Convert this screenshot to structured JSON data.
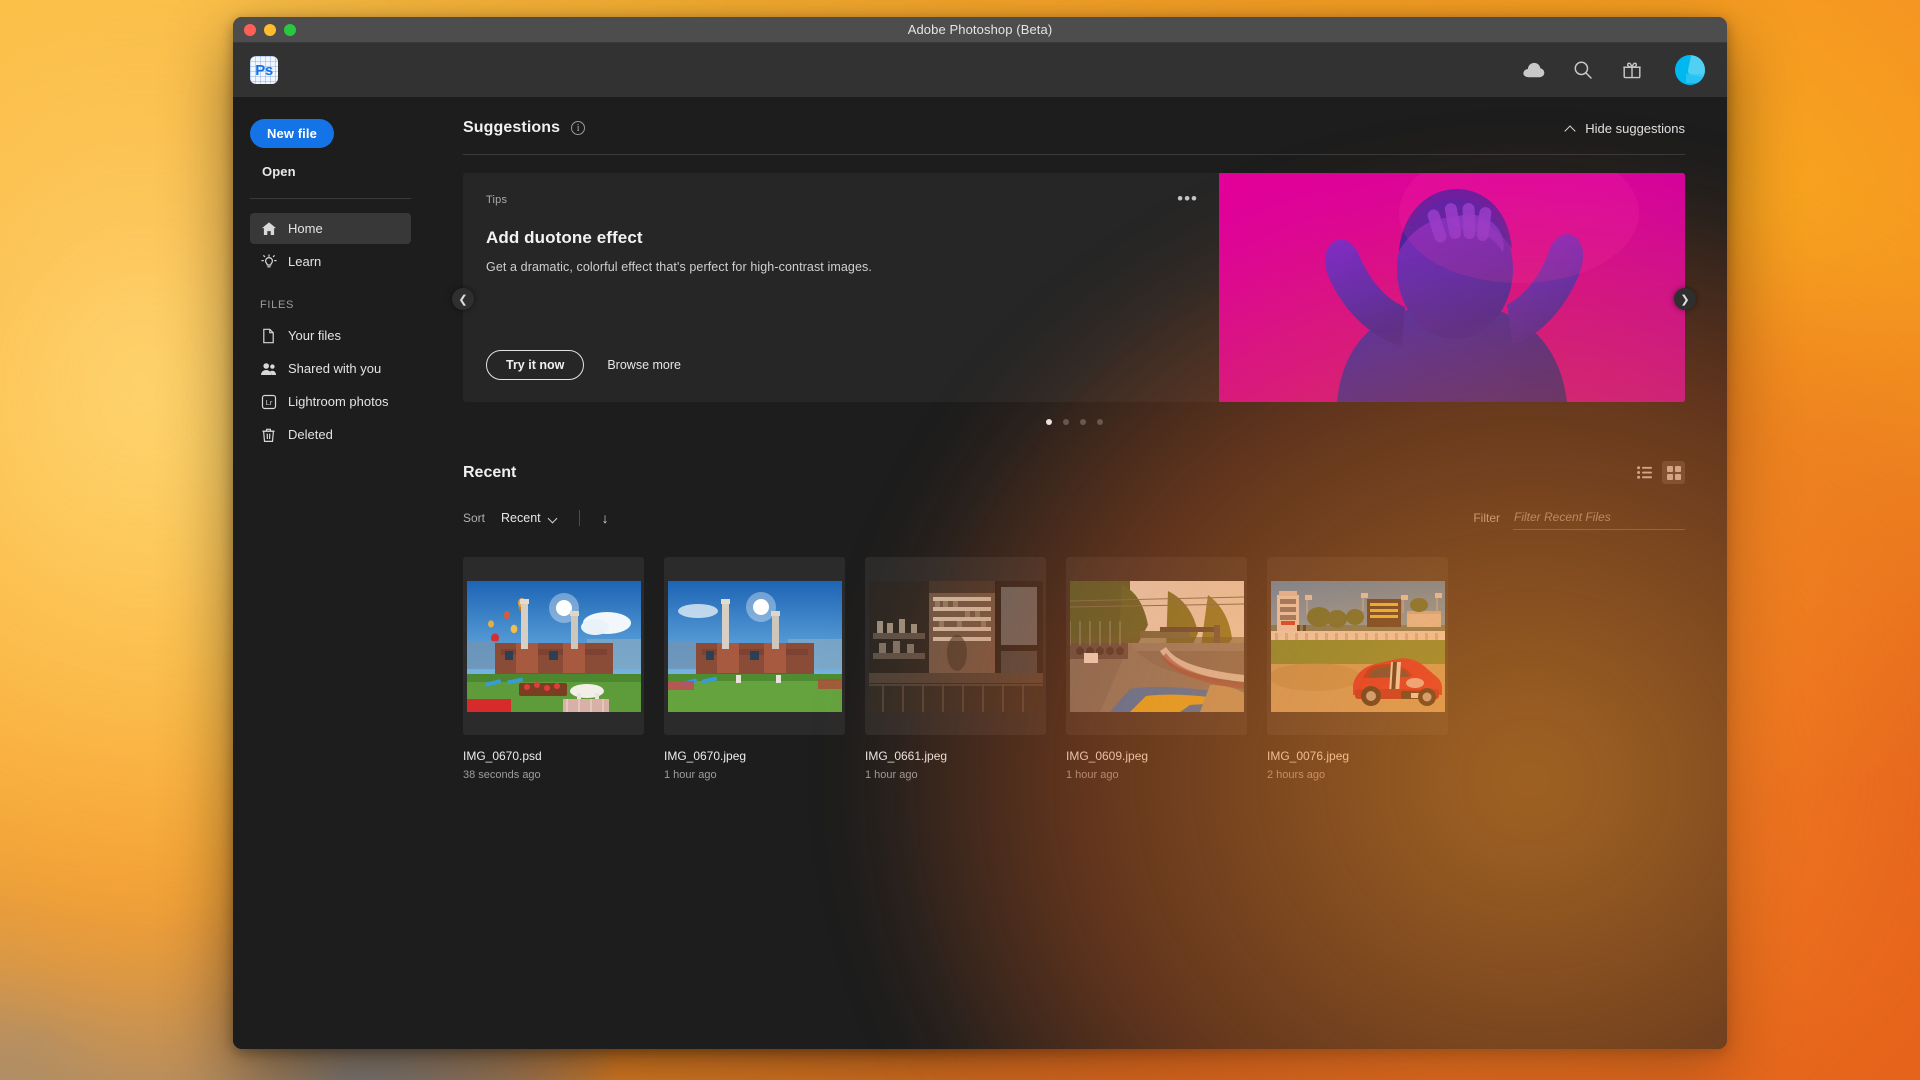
{
  "window": {
    "title": "Adobe Photoshop (Beta)",
    "traffic_lights": [
      "close",
      "minimize",
      "maximize"
    ]
  },
  "appbar": {
    "logo_text": "Ps",
    "icons": [
      "cloud-icon",
      "search-icon",
      "gift-icon",
      "avatar"
    ]
  },
  "sidebar": {
    "new_file_label": "New file",
    "open_label": "Open",
    "primary_items": [
      {
        "label": "Home",
        "icon": "home-icon",
        "active": true
      },
      {
        "label": "Learn",
        "icon": "lightbulb-icon",
        "active": false
      }
    ],
    "files_section_label": "FILES",
    "file_items": [
      {
        "label": "Your files",
        "icon": "document-icon"
      },
      {
        "label": "Shared with you",
        "icon": "people-icon"
      },
      {
        "label": "Lightroom photos",
        "icon": "lightroom-icon"
      },
      {
        "label": "Deleted",
        "icon": "trash-icon"
      }
    ]
  },
  "suggestions": {
    "title": "Suggestions",
    "info_icon": "info-icon",
    "hide_label": "Hide suggestions",
    "card": {
      "eyebrow": "Tips",
      "title": "Add duotone effect",
      "description": "Get a dramatic, colorful effect that's perfect for high-contrast images.",
      "primary_action": "Try it now",
      "secondary_action": "Browse more",
      "more_icon": "ellipsis-icon",
      "image_alt": "duotone-portrait"
    },
    "prev_icon": "chevron-left-icon",
    "next_icon": "chevron-right-icon",
    "pager": {
      "count": 4,
      "active_index": 0
    }
  },
  "recent": {
    "title": "Recent",
    "view_modes": [
      {
        "name": "list-view",
        "icon": "list-icon",
        "active": false
      },
      {
        "name": "grid-view",
        "icon": "grid-icon",
        "active": true
      }
    ],
    "sort_label": "Sort",
    "sort_value": "Recent",
    "sort_direction_icon": "arrow-down-icon",
    "filter_label": "Filter",
    "filter_placeholder": "Filter Recent Files",
    "filter_value": "",
    "files": [
      {
        "name": "IMG_0670.psd",
        "time": "38 seconds ago",
        "art": "battersea-balloons"
      },
      {
        "name": "IMG_0670.jpeg",
        "time": "1 hour ago",
        "art": "battersea-plain"
      },
      {
        "name": "IMG_0661.jpeg",
        "time": "1 hour ago",
        "art": "interior-loft"
      },
      {
        "name": "IMG_0609.jpeg",
        "time": "1 hour ago",
        "art": "race-track"
      },
      {
        "name": "IMG_0076.jpeg",
        "time": "2 hours ago",
        "art": "red-sportscar"
      }
    ]
  },
  "colors": {
    "accent": "#1473e6",
    "window_bg": "#1d1d1d",
    "appbar_bg": "#323232",
    "card_bg": "#262626",
    "titlebar_bg": "#4d4d4d",
    "avatar": "#00b8f0",
    "duotone_magenta": "#e10093",
    "duotone_blue": "#5b35d8"
  }
}
